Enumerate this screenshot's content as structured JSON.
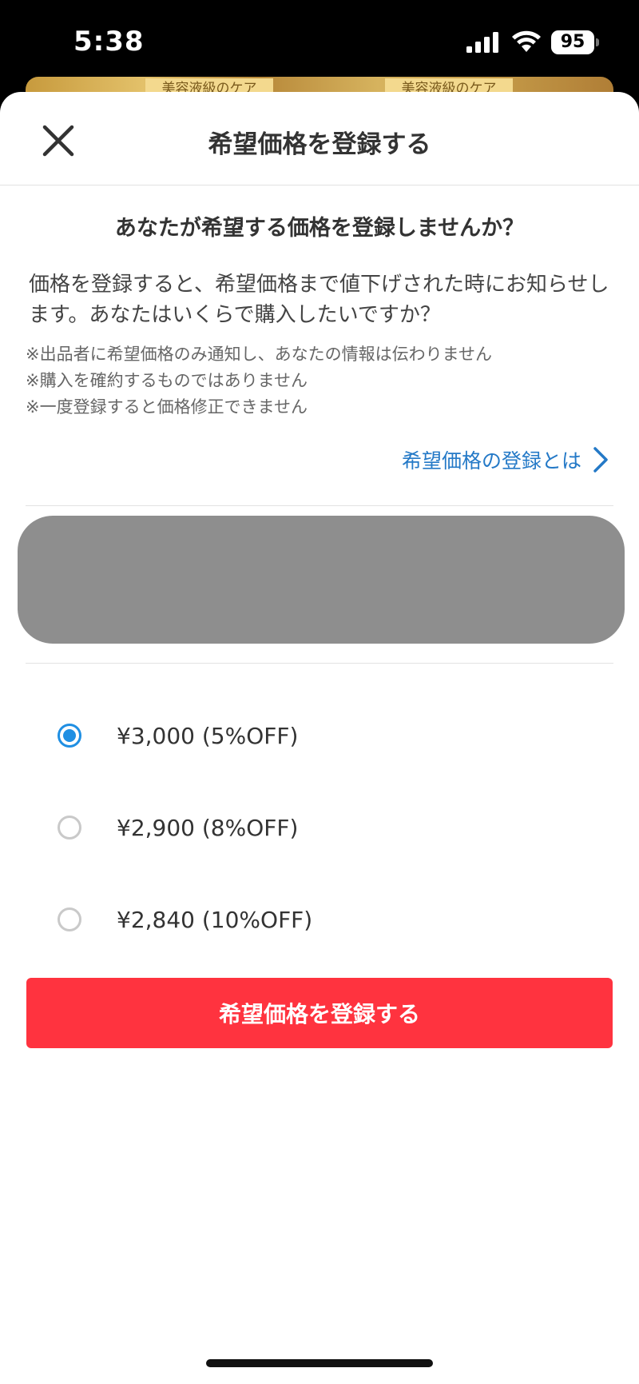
{
  "status_bar": {
    "time": "5:38",
    "battery": "95"
  },
  "background": {
    "product_label_1": "美容液級のケア",
    "product_label_2": "美容液級のケア"
  },
  "sheet": {
    "title": "希望価格を登録する",
    "question": "あなたが希望する価格を登録しませんか？",
    "description": "価格を登録すると、希望価格まで値下げされた時にお知らせします。あなたはいくらで購入したいですか？",
    "notes": [
      "※出品者に希望価格のみ通知し、あなたの情報は伝わりません",
      "※購入を確約するものではありません",
      "※一度登録すると価格修正できません"
    ],
    "help_link": "希望価格の登録とは"
  },
  "price_options": [
    {
      "label": "¥3,000 (5%OFF)",
      "selected": true
    },
    {
      "label": "¥2,900 (8%OFF)",
      "selected": false
    },
    {
      "label": "¥2,840 (10%OFF)",
      "selected": false
    }
  ],
  "submit_label": "希望価格を登録する",
  "colors": {
    "accent_blue": "#1f8fe3",
    "link_blue": "#2479c7",
    "submit_red": "#ff333f",
    "redacted_gray": "#8e8e8e"
  },
  "icons": {
    "close": "close-icon",
    "help_chevron": "chevron-right-icon",
    "signal": "cellular-signal-icon",
    "wifi": "wifi-icon",
    "battery": "battery-icon"
  }
}
